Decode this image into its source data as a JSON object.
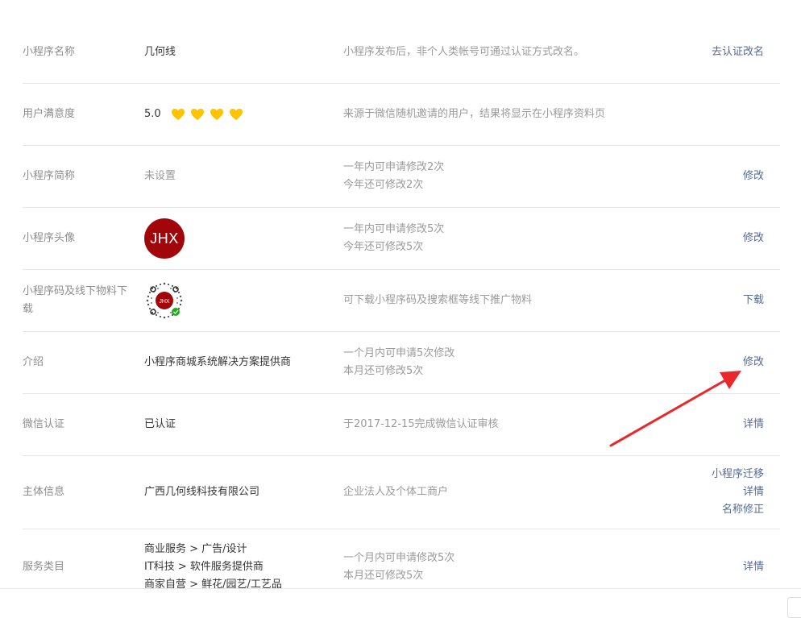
{
  "rows": [
    {
      "label": "小程序名称",
      "value": "几何线",
      "desc": [
        "小程序发布后，非个人类帐号可通过认证方式改名。"
      ],
      "actions": [
        "去认证改名"
      ]
    },
    {
      "label": "用户满意度",
      "score": "5.0",
      "hearts": 4,
      "desc": [
        "来源于微信随机邀请的用户，结果将显示在小程序资料页"
      ],
      "actions": []
    },
    {
      "label": "小程序简称",
      "value": "未设置",
      "desc": [
        "一年内可申请修改2次",
        "今年还可修改2次"
      ],
      "actions": [
        "修改"
      ]
    },
    {
      "label": "小程序头像",
      "avatar_text": "JHX",
      "desc": [
        "一年内可申请修改5次",
        "今年还可修改5次"
      ],
      "actions": [
        "修改"
      ]
    },
    {
      "label": "小程序码及线下物料下载",
      "qr_text": "JHX",
      "desc": [
        "可下载小程序码及搜索框等线下推广物料"
      ],
      "actions": [
        "下载"
      ]
    },
    {
      "label": "介绍",
      "value": "小程序商城系统解决方案提供商",
      "desc": [
        "一个月内可申请5次修改",
        "本月还可修改5次"
      ],
      "actions": [
        "修改"
      ]
    },
    {
      "label": "微信认证",
      "value": "已认证",
      "desc": [
        "于2017-12-15完成微信认证审核"
      ],
      "actions": [
        "详情"
      ]
    },
    {
      "label": "主体信息",
      "value": "广西几何线科技有限公司",
      "desc": [
        "企业法人及个体工商户"
      ],
      "actions": [
        "小程序迁移",
        "详情",
        "名称修正"
      ]
    },
    {
      "label": "服务类目",
      "categories": [
        "商业服务 > 广告/设计",
        "IT科技 > 软件服务提供商",
        "商家自营 > 鲜花/园艺/工艺品"
      ],
      "desc": [
        "一个月内可申请修改5次",
        "本月还可修改5次"
      ],
      "actions": [
        "详情"
      ]
    }
  ],
  "colors": {
    "link": "#576b95",
    "heart": "#ffc300",
    "avatar": "#a1060b",
    "arrow": "#e8282b"
  }
}
